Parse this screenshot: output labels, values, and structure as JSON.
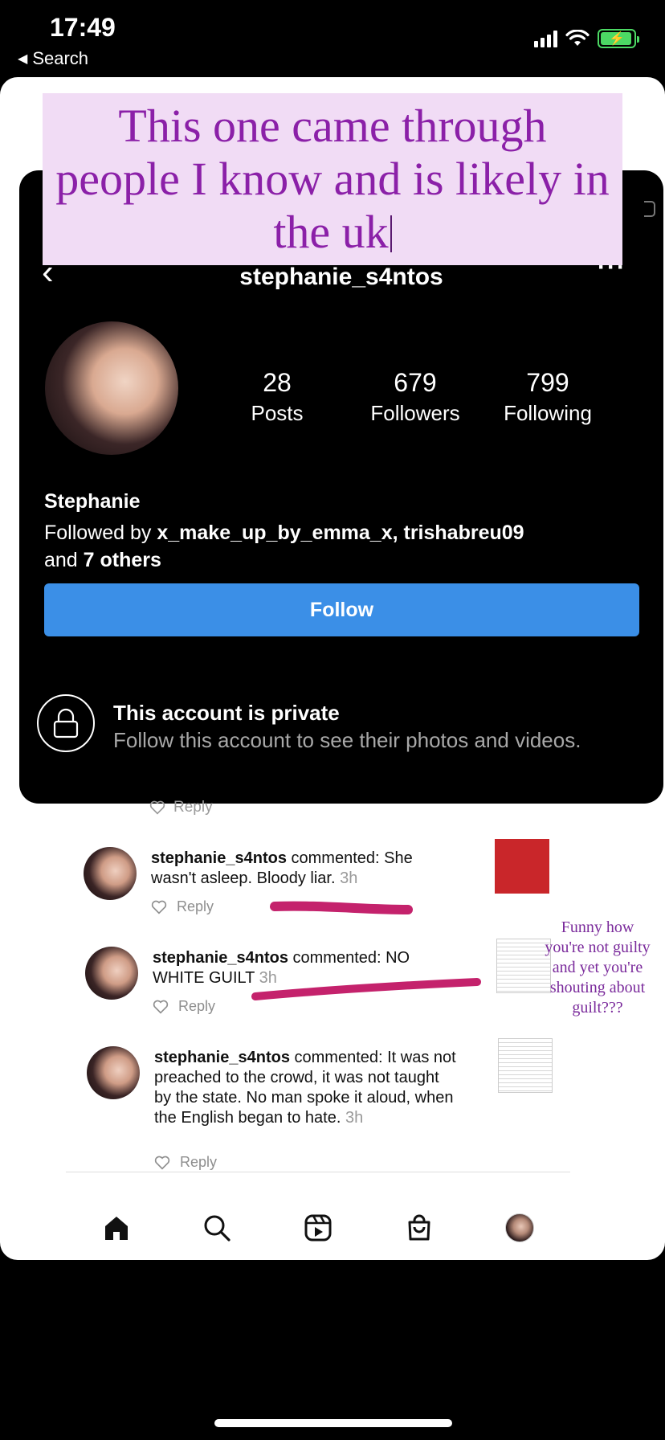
{
  "status_bar": {
    "time": "17:49",
    "back_label": "Search"
  },
  "overlay": {
    "text": "This one came through people I know and is likely in the uk",
    "bg_color": "#f1dcf5",
    "text_color": "#8b20a8"
  },
  "profile": {
    "username": "stephanie_s4ntos",
    "posts_count": "28",
    "posts_label": "Posts",
    "followers_count": "679",
    "followers_label": "Followers",
    "following_count": "799",
    "following_label": "Following",
    "name": "Stephanie",
    "followed_prefix": "Followed by ",
    "followed_users": "x_make_up_by_emma_x, trishabreu09",
    "followed_and": "and ",
    "followed_others": "7 others",
    "follow_button": "Follow",
    "private_title": "This account is private",
    "private_subtitle": "Follow this account to see their photos and videos.",
    "accent_color": "#3b8fe7"
  },
  "comments": {
    "top_reply_label": "Reply",
    "items": [
      {
        "user": "stephanie_s4ntos",
        "text": " commented: She wasn't asleep. Bloody liar.",
        "time": " 3h",
        "reply_label": "Reply"
      },
      {
        "user": "stephanie_s4ntos",
        "text": " commented: NO WHITE GUILT",
        "time": " 3h",
        "reply_label": "Reply"
      },
      {
        "user": "stephanie_s4ntos",
        "text": " commented: It was not preached to the crowd, it was not taught by the state. No man spoke it aloud, when the English began to hate.",
        "time": " 3h",
        "reply_label": "Reply"
      }
    ]
  },
  "annotation": {
    "note": "Funny how you're not guilty and yet you're shouting about guilt???",
    "strike_color": "#c4226c"
  },
  "bottom_nav": {
    "items": [
      "home-icon",
      "search-icon",
      "reels-icon",
      "shop-icon",
      "profile-avatar"
    ]
  }
}
